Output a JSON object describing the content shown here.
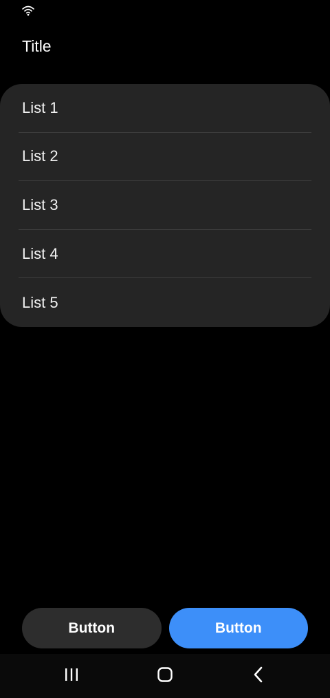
{
  "status_bar": {
    "wifi_icon": "wifi-icon"
  },
  "header": {
    "title": "Title"
  },
  "list": {
    "items": [
      {
        "label": "List 1"
      },
      {
        "label": "List 2"
      },
      {
        "label": "List 3"
      },
      {
        "label": "List 4"
      },
      {
        "label": "List 5"
      }
    ]
  },
  "buttons": {
    "secondary_label": "Button",
    "primary_label": "Button"
  },
  "nav_bar": {
    "recents_icon": "recents-icon",
    "home_icon": "home-icon",
    "back_icon": "back-icon"
  },
  "colors": {
    "background": "#000000",
    "card": "#252525",
    "divider": "#3c3c3c",
    "secondary_button": "#2d2d2d",
    "primary_button": "#3d8ff9"
  }
}
